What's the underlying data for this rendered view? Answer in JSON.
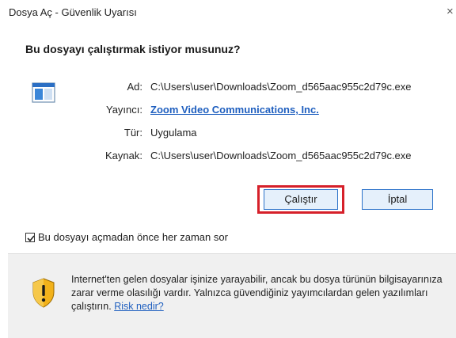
{
  "window": {
    "title": "Dosya Aç - Güvenlik Uyarısı",
    "close_glyph": "×"
  },
  "dialog": {
    "question": "Bu dosyayı çalıştırmak istiyor musunuz?",
    "fields": [
      {
        "label": "Ad:",
        "value": "C:\\Users\\user\\Downloads\\Zoom_d565aac955c2d79c.exe"
      },
      {
        "label": "Yayıncı:",
        "value": "Zoom Video Communications, Inc."
      },
      {
        "label": "Tür:",
        "value": "Uygulama"
      },
      {
        "label": "Kaynak:",
        "value": "C:\\Users\\user\\Downloads\\Zoom_d565aac955c2d79c.exe"
      }
    ],
    "buttons": {
      "run": "Çalıştır",
      "cancel": "İptal"
    },
    "checkbox": {
      "label": "Bu dosyayı açmadan önce her zaman sor",
      "checked": true
    }
  },
  "info": {
    "text": "Internet'ten gelen dosyalar işinize yarayabilir, ancak bu dosya türünün bilgisayarınıza zarar verme olasılığı vardır. Yalnızca güvendiğiniz yayımcılardan gelen yazılımları çalıştırın.",
    "link": "Risk nedir?"
  },
  "colors": {
    "link": "#1f5fbf",
    "highlight": "#d6202a",
    "button_border": "#2b72c9",
    "button_bg": "#e5f0fb",
    "info_bg": "#f0f0f0"
  },
  "icons": {
    "app": "application-window-icon",
    "shield": "security-shield-icon",
    "check": "checkmark-icon"
  }
}
